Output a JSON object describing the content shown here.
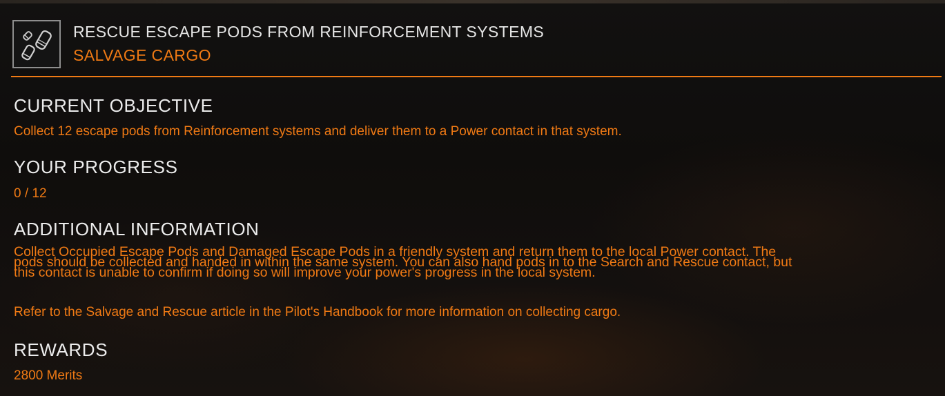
{
  "mission": {
    "icon": "escape-pods-icon",
    "title": "RESCUE ESCAPE PODS FROM REINFORCEMENT SYSTEMS",
    "type": "SALVAGE CARGO"
  },
  "sections": {
    "current_objective": {
      "heading": "CURRENT OBJECTIVE",
      "text": "Collect 12 escape pods from Reinforcement systems and deliver them to a Power contact in that system."
    },
    "your_progress": {
      "heading": "YOUR PROGRESS",
      "text": "0 / 12"
    },
    "additional_information": {
      "heading": "ADDITIONAL INFORMATION",
      "lines": [
        "Collect Occupied Escape Pods and Damaged Escape Pods in a friendly system and return them to the local Power contact. The",
        "pods should be collected and handed in within the same system. You can also hand pods in to the Search and Rescue contact, but",
        "this contact is unable to confirm if doing so will improve your power's progress in the local system."
      ],
      "note": "Refer to the Salvage and Rescue article in the Pilot's Handbook for more information on collecting cargo."
    },
    "rewards": {
      "heading": "REWARDS",
      "text": "2800 Merits"
    }
  },
  "colors": {
    "accent": "#f07a14",
    "heading": "#ececec",
    "background": "#0f0d0c"
  }
}
